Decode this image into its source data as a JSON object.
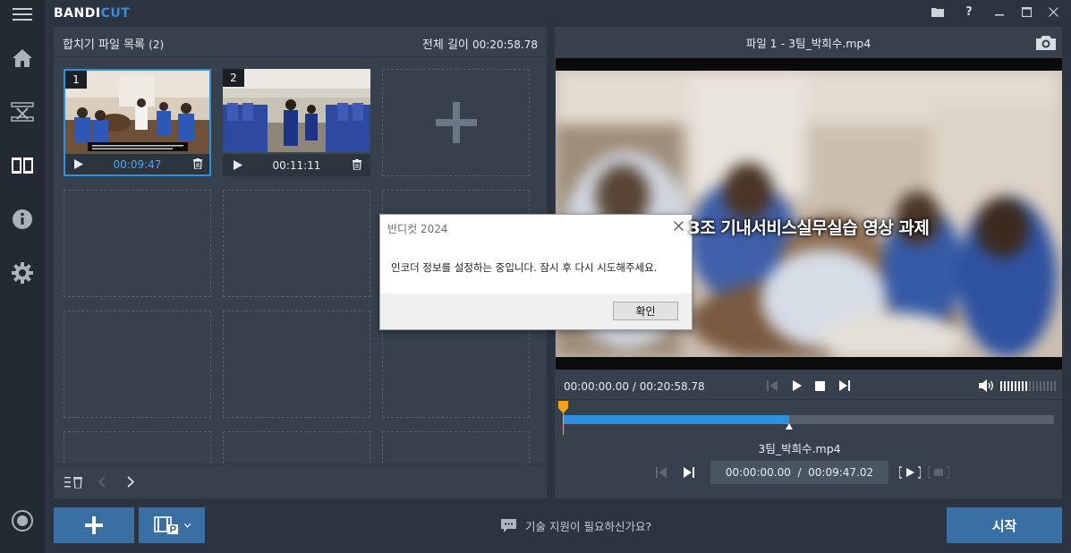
{
  "app": {
    "logo_main": "BANDI",
    "logo_accent": "CUT"
  },
  "sidebar": {
    "items": [
      {
        "icon": "menu-icon"
      },
      {
        "icon": "home-icon"
      },
      {
        "icon": "cutter-icon"
      },
      {
        "icon": "joiner-icon"
      },
      {
        "icon": "info-icon"
      },
      {
        "icon": "settings-icon"
      },
      {
        "icon": "record-icon"
      }
    ]
  },
  "titlebar": {
    "icons": [
      "folder-icon",
      "help-icon",
      "minimize-icon",
      "maximize-icon",
      "close-icon"
    ],
    "help_label": "?"
  },
  "left_panel": {
    "title": "합치기 파일 목록",
    "count": "(2)",
    "total_label": "전체 길이",
    "total_time": "00:20:58.78",
    "clips": [
      {
        "num": "1",
        "duration": "00:09:47",
        "selected": true
      },
      {
        "num": "2",
        "duration": "00:11:11",
        "selected": false
      }
    ]
  },
  "right_panel": {
    "file_title": "파일 1 - 3팀_박희수.mp4",
    "subtitle": "3조 기내서비스실무실습 영상 과제",
    "time_current": "00:00:00.00",
    "time_sep": "/",
    "time_total": "00:20:58.78",
    "segment_file": "3팀_박희수.mp4",
    "segment_time": "00:00:00.00  /  00:09:47.02",
    "progress_fraction": 0.46
  },
  "bottom": {
    "support_text": "기술 지원이 필요하신가요?",
    "start_label": "시작"
  },
  "dialog": {
    "title": "반디컷 2024",
    "message": "인코더 정보를 설정하는 중입니다. 잠시 후 다시 시도해주세요.",
    "ok_label": "확인"
  },
  "colors": {
    "accent": "#2f90e0",
    "playhead": "#f2a31b",
    "button": "#3a6fa3"
  }
}
